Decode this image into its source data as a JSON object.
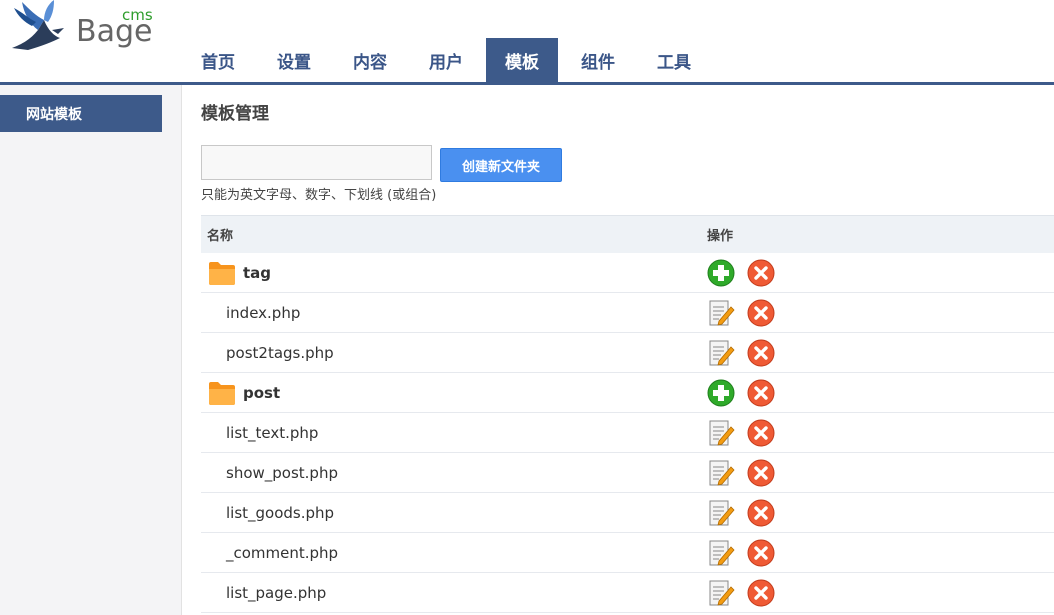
{
  "logo": {
    "word": "Bage",
    "cms": "cms"
  },
  "nav": {
    "tabs": [
      {
        "label": "首页",
        "active": false
      },
      {
        "label": "设置",
        "active": false
      },
      {
        "label": "内容",
        "active": false
      },
      {
        "label": "用户",
        "active": false
      },
      {
        "label": "模板",
        "active": true
      },
      {
        "label": "组件",
        "active": false
      },
      {
        "label": "工具",
        "active": false
      }
    ]
  },
  "sidebar": {
    "items": [
      {
        "label": "网站模板",
        "active": true
      }
    ]
  },
  "main": {
    "title": "模板管理",
    "folder_input": {
      "value": "",
      "placeholder": ""
    },
    "create_button": "创建新文件夹",
    "hint": "只能为英文字母、数字、下划线 (或组合)",
    "table": {
      "headers": {
        "name": "名称",
        "operation": "操作"
      },
      "rows": [
        {
          "name": "tag",
          "type": "folder"
        },
        {
          "name": "index.php",
          "type": "file"
        },
        {
          "name": "post2tags.php",
          "type": "file"
        },
        {
          "name": "post",
          "type": "folder"
        },
        {
          "name": "list_text.php",
          "type": "file"
        },
        {
          "name": "show_post.php",
          "type": "file"
        },
        {
          "name": "list_goods.php",
          "type": "file"
        },
        {
          "name": "_comment.php",
          "type": "file"
        },
        {
          "name": "list_page.php",
          "type": "file"
        }
      ]
    }
  },
  "colors": {
    "nav_active": "#3d5a8a",
    "nav_text": "#3b5688",
    "button": "#4a90f0",
    "add_icon": "#2faa2a",
    "delete_icon": "#ef5a35",
    "folder": "#f7941d"
  }
}
